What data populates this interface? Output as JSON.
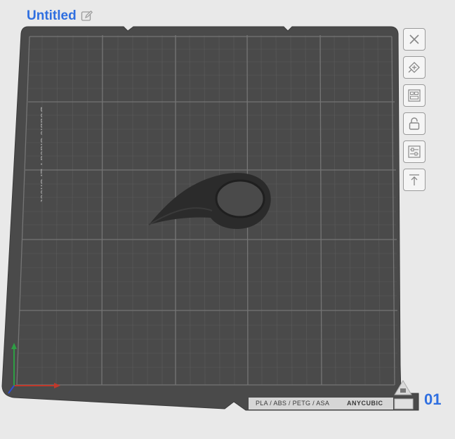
{
  "project": {
    "title": "Untitled",
    "edit_icon": "pencil-icon"
  },
  "plate": {
    "sheet_label": "Double Sided PEI Sheet",
    "material_label": "PLA / ABS / PETG / ASA",
    "brand_label": "ANYCUBIC",
    "number": "01"
  },
  "toolbar": {
    "items": [
      {
        "icon": "close-icon"
      },
      {
        "icon": "auto-orient-icon"
      },
      {
        "icon": "arrange-icon"
      },
      {
        "icon": "lock-icon"
      },
      {
        "icon": "plate-settings-icon"
      },
      {
        "icon": "move-to-top-icon"
      }
    ]
  },
  "colors": {
    "accent": "#2f6fe0",
    "plate": "#4a4a4a",
    "grid": "#6e6e6e",
    "model": "#2b2b2b"
  }
}
